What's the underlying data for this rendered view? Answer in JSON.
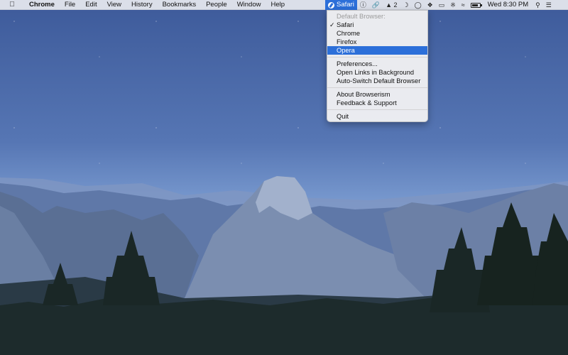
{
  "menubar": {
    "app_name": "Chrome",
    "menus": [
      "File",
      "Edit",
      "View",
      "History",
      "Bookmarks",
      "People",
      "Window",
      "Help"
    ],
    "status": {
      "browser_label": "Safari",
      "badge_count": "2",
      "clock": "Wed 8:30 PM"
    }
  },
  "browser_menu": {
    "section_header": "Default Browser:",
    "browsers": [
      "Safari",
      "Chrome",
      "Firefox",
      "Opera"
    ],
    "checked_browser": "Safari",
    "highlighted_item": "Opera",
    "options": [
      "Preferences...",
      "Open Links in Background",
      "Auto-Switch Default Browser"
    ],
    "info": [
      "About Browserism",
      "Feedback & Support"
    ],
    "quit_label": "Quit"
  },
  "colors": {
    "accent": "#2c6fd9",
    "menubar_bg": "#e8eaf0"
  },
  "battery_level": 0.85
}
